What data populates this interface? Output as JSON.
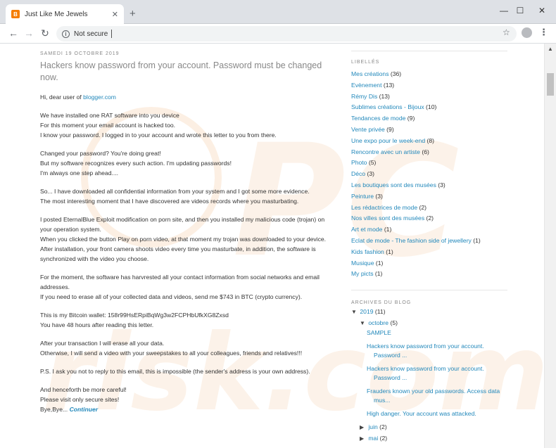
{
  "browser": {
    "tab_title": "Just Like Me Jewels",
    "tab_close": "✕",
    "new_tab": "+",
    "url_security": "Not secure",
    "win_min": "—",
    "win_max": "☐",
    "win_close": "✕"
  },
  "post": {
    "date": "SAMEDI 19 OCTOBRE 2019",
    "title": "Hackers know password from your account. Password must be changed now.",
    "greeting_prefix": "Hi, dear user of ",
    "greeting_link": "blogger.com",
    "paragraphs": [
      [
        "We have installed one RAT software into you device",
        "For this moment your email account is hacked too.",
        "I know your password. I logged in to your account and wrote this letter to you from there."
      ],
      [
        "Changed your password? You're doing great!",
        "But my software recognizes every such action. I'm updating passwords!",
        "I'm always one step ahead...."
      ],
      [
        "So... I have downloaded all confidential information from your system and I got some more evidence.",
        "The most interesting moment that I have discovered are videos records where you masturbating."
      ],
      [
        "I posted EternalBlue Exploit modification on porn site, and then you installed my malicious code (trojan) on your operation system.",
        "When you clicked the button Play on porn video, at that moment my trojan was downloaded to your device.",
        "After installation, your front camera shoots video every time you masturbate, in addition, the software is synchronized with the video you choose."
      ],
      [
        "For the moment, the software has harvrested all your contact information from social networks and email addresses.",
        "If you need to erase all of your collected data and videos, send me $743 in BTC (crypto currency)."
      ],
      [
        "This is my Bitcoin wallet: 158r99HsERpiBqWg3w2FCPHbUfkXG8Zxsd",
        "You have 48 hours after reading this letter."
      ],
      [
        "After your transaction I will erase all your data.",
        "Otherwise, I will send a video with your sweepstakes to all your colleagues, friends and relatives!!!"
      ],
      [
        "P.S. I ask you not to reply to this email, this is impossible (the sender's address is your own address)."
      ],
      [
        "And henceforth be more careful!",
        "Please visit only secure sites!"
      ]
    ],
    "closing_prefix": "Bye,Bye... ",
    "continue_link": "Continuer"
  },
  "sidebar": {
    "labels_title": "LIBELLÉS",
    "labels": [
      {
        "name": "Mes créations",
        "count": "(36)"
      },
      {
        "name": "Evènement",
        "count": "(13)"
      },
      {
        "name": "Rémy Dis",
        "count": "(13)"
      },
      {
        "name": "Sublimes créations - Bijoux",
        "count": "(10)"
      },
      {
        "name": "Tendances de mode",
        "count": "(9)"
      },
      {
        "name": "Vente privée",
        "count": "(9)"
      },
      {
        "name": "Une expo pour le week-end",
        "count": "(8)"
      },
      {
        "name": "Rencontre avec un artiste",
        "count": "(6)"
      },
      {
        "name": "Photo",
        "count": "(5)"
      },
      {
        "name": "Déco",
        "count": "(3)"
      },
      {
        "name": "Les boutiques sont des musées",
        "count": "(3)"
      },
      {
        "name": "Peinture",
        "count": "(3)"
      },
      {
        "name": "Les rédactrices de mode",
        "count": "(2)"
      },
      {
        "name": "Nos villes sont des musées",
        "count": "(2)"
      },
      {
        "name": "Art et mode",
        "count": "(1)"
      },
      {
        "name": "Eclat de mode - The fashion side of jewellery",
        "count": "(1)"
      },
      {
        "name": "Kids fashion",
        "count": "(1)"
      },
      {
        "name": "Musique",
        "count": "(1)"
      },
      {
        "name": "My picts",
        "count": "(1)"
      }
    ],
    "archive_title": "ARCHIVES DU BLOG",
    "year": {
      "name": "2019",
      "count": "(11)"
    },
    "month": {
      "name": "octobre",
      "count": "(5)"
    },
    "posts": [
      {
        "line1": "SAMPLE",
        "line2": ""
      },
      {
        "line1": "Hackers know password from your account.",
        "line2": "Password ..."
      },
      {
        "line1": "Hackers know password from your account.",
        "line2": "Password ..."
      },
      {
        "line1": "Frauders known your old passwords. Access data",
        "line2": "mus..."
      },
      {
        "line1": "High danger. Your account was attacked.",
        "line2": ""
      }
    ],
    "juin": {
      "name": "juin",
      "count": "(2)"
    },
    "mai": {
      "name": "mai",
      "count": "(2)"
    }
  },
  "colors": {
    "link": "#2288bb",
    "watermark": "#f2b47a"
  }
}
